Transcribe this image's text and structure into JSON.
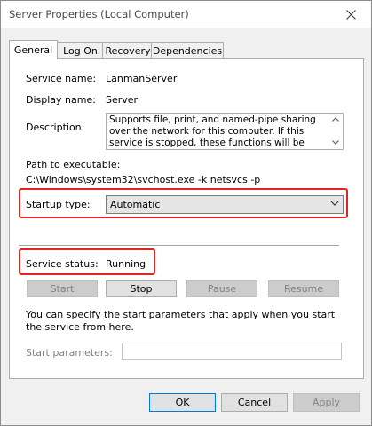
{
  "window": {
    "title": "Server Properties (Local Computer)"
  },
  "tabs": [
    {
      "label": "General",
      "active": true
    },
    {
      "label": "Log On",
      "active": false
    },
    {
      "label": "Recovery",
      "active": false
    },
    {
      "label": "Dependencies",
      "active": false
    }
  ],
  "general": {
    "service_name_label": "Service name:",
    "service_name_value": "LanmanServer",
    "display_name_label": "Display name:",
    "display_name_value": "Server",
    "description_label": "Description:",
    "description_value": "Supports file, print, and named-pipe sharing over the network for this computer. If this service is stopped, these functions will be unavailable. If this service is",
    "path_label": "Path to executable:",
    "path_value": "C:\\Windows\\system32\\svchost.exe -k netsvcs -p",
    "startup_type_label": "Startup type:",
    "startup_type_value": "Automatic",
    "service_status_label": "Service status:",
    "service_status_value": "Running",
    "buttons": {
      "start": "Start",
      "stop": "Stop",
      "pause": "Pause",
      "resume": "Resume"
    },
    "params_note": "You can specify the start parameters that apply when you start the service from here.",
    "start_params_label": "Start parameters:",
    "start_params_value": ""
  },
  "footer": {
    "ok": "OK",
    "cancel": "Cancel",
    "apply": "Apply"
  },
  "colors": {
    "highlight_box": "#e02424",
    "focus_border": "#0078d7"
  },
  "icons": {
    "close": "close-icon",
    "description_scroll_up": "scroll-up-icon",
    "description_scroll_down": "scroll-down-icon",
    "dropdown": "chevron-down-icon"
  }
}
